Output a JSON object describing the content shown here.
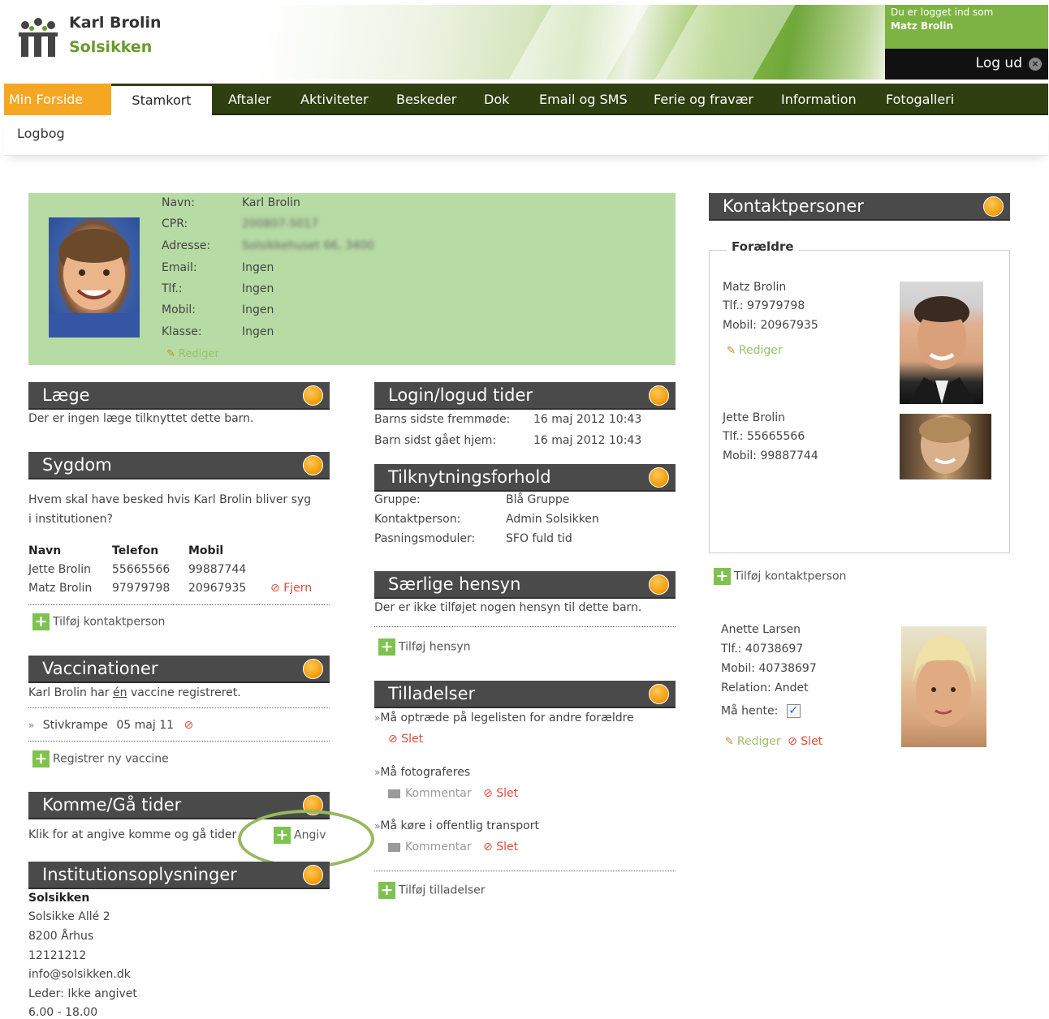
{
  "header": {
    "child_name": "Karl Brolin",
    "institution": "Solsikken",
    "login_label": "Du er logget ind som",
    "login_user": "Matz Brolin",
    "logout_label": "Log ud",
    "logout_icon": "×"
  },
  "nav": {
    "items": [
      {
        "label": "Min Forside"
      },
      {
        "label": "Stamkort"
      },
      {
        "label": "Aftaler"
      },
      {
        "label": "Aktiviteter"
      },
      {
        "label": "Beskeder"
      },
      {
        "label": "Dok"
      },
      {
        "label": "Email og SMS"
      },
      {
        "label": "Ferie og fravær"
      },
      {
        "label": "Information"
      },
      {
        "label": "Fotogalleri"
      }
    ],
    "sub_item": "Logbog",
    "active": "Stamkort"
  },
  "profile": {
    "labels": {
      "name": "Navn:",
      "cpr": "CPR:",
      "address": "Adresse:",
      "email": "Email:",
      "phone": "Tlf.:",
      "mobile": "Mobil:",
      "class": "Klasse:"
    },
    "values": {
      "name": "Karl Brolin",
      "cpr": "200807-5017",
      "address": "Solsikkehuset 66, 3400",
      "email": "Ingen",
      "phone": "Ingen",
      "mobile": "Ingen",
      "class": "Ingen"
    },
    "edit": "Rediger"
  },
  "laege": {
    "title": "Læge",
    "text": "Der er ingen læge tilknyttet dette barn."
  },
  "sygdom": {
    "title": "Sygdom",
    "question_line1": "Hvem skal have besked hvis Karl Brolin bliver syg",
    "question_line2": "i institutionen?",
    "columns": [
      "Navn",
      "Telefon",
      "Mobil"
    ],
    "rows": [
      {
        "name": "Jette Brolin",
        "phone": "55665566",
        "mobile": "99887744",
        "action": ""
      },
      {
        "name": "Matz Brolin",
        "phone": "97979798",
        "mobile": "20967935",
        "action": "Fjern"
      }
    ],
    "add": "Tilføj kontaktperson"
  },
  "vaccinationer": {
    "title": "Vaccinationer",
    "text_pre": "Karl Brolin har ",
    "text_em": "én",
    "text_post": " vaccine registreret.",
    "item_name": "Stivkrampe",
    "item_date": "05 maj 11",
    "add": "Registrer ny vaccine"
  },
  "komme": {
    "title": "Komme/Gå tider",
    "text": "Klik for at angive komme og gå tider",
    "action": "Angiv"
  },
  "institution": {
    "title": "Institutionsoplysninger",
    "name": "Solsikken",
    "street": "Solsikke Allé 2",
    "city": "8200 Århus",
    "phone": "12121212",
    "email": "info@solsikken.dk",
    "leader": "Leder: Ikke angivet",
    "hours": "6.00 - 18.00"
  },
  "login_times": {
    "title": "Login/logud tider",
    "rows": [
      {
        "label": "Barns sidste fremmøde:",
        "value": "16 maj 2012 10:43"
      },
      {
        "label": "Barn sidst gået hjem:",
        "value": "16 maj 2012 10:43"
      }
    ]
  },
  "tilknytning": {
    "title": "Tilknytningsforhold",
    "rows": [
      {
        "label": "Gruppe:",
        "value": "Blå Gruppe"
      },
      {
        "label": "Kontaktperson:",
        "value": "Admin Solsikken"
      },
      {
        "label": "Pasningsmoduler:",
        "value": "SFO fuld tid"
      }
    ]
  },
  "saerlige": {
    "title": "Særlige hensyn",
    "text": "Der er ikke tilføjet nogen hensyn til dette barn.",
    "add": "Tilføj hensyn"
  },
  "tilladelser": {
    "title": "Tilladelser",
    "items": [
      {
        "text": "Må optræde på legelisten for andre forældre",
        "comment": "",
        "delete": "Slet"
      },
      {
        "text": "Må fotograferes",
        "comment": "Kommentar",
        "delete": "Slet"
      },
      {
        "text": "Må køre i offentlig transport",
        "comment": "Kommentar",
        "delete": "Slet"
      }
    ],
    "add": "Tilføj tilladelser"
  },
  "kontaktpersoner": {
    "title": "Kontaktpersoner",
    "group_label": "Forældre",
    "parents": [
      {
        "name": "Matz Brolin",
        "phone": "Tlf.: 97979798",
        "mobile": "Mobil: 20967935",
        "edit": "Rediger"
      },
      {
        "name": "Jette Brolin",
        "phone": "Tlf.: 55665566",
        "mobile": "Mobil: 99887744"
      }
    ],
    "add": "Tilføj kontaktperson",
    "other": {
      "name": "Anette Larsen",
      "phone": "Tlf.: 40738697",
      "mobile": "Mobil: 40738697",
      "relation": "Relation: Andet",
      "pickup_label": "Må hente:",
      "pickup_checked": true,
      "edit": "Rediger",
      "delete": "Slet"
    }
  },
  "colors": {
    "nav_bg": "#2e3f10",
    "nav_active": "#f5a623",
    "profile_bg": "#b7dba5",
    "section_header": "#4a4a4a",
    "accent_orange": "#f5a00f",
    "delete_red": "#e24a3b",
    "add_green": "#7ec24f"
  }
}
